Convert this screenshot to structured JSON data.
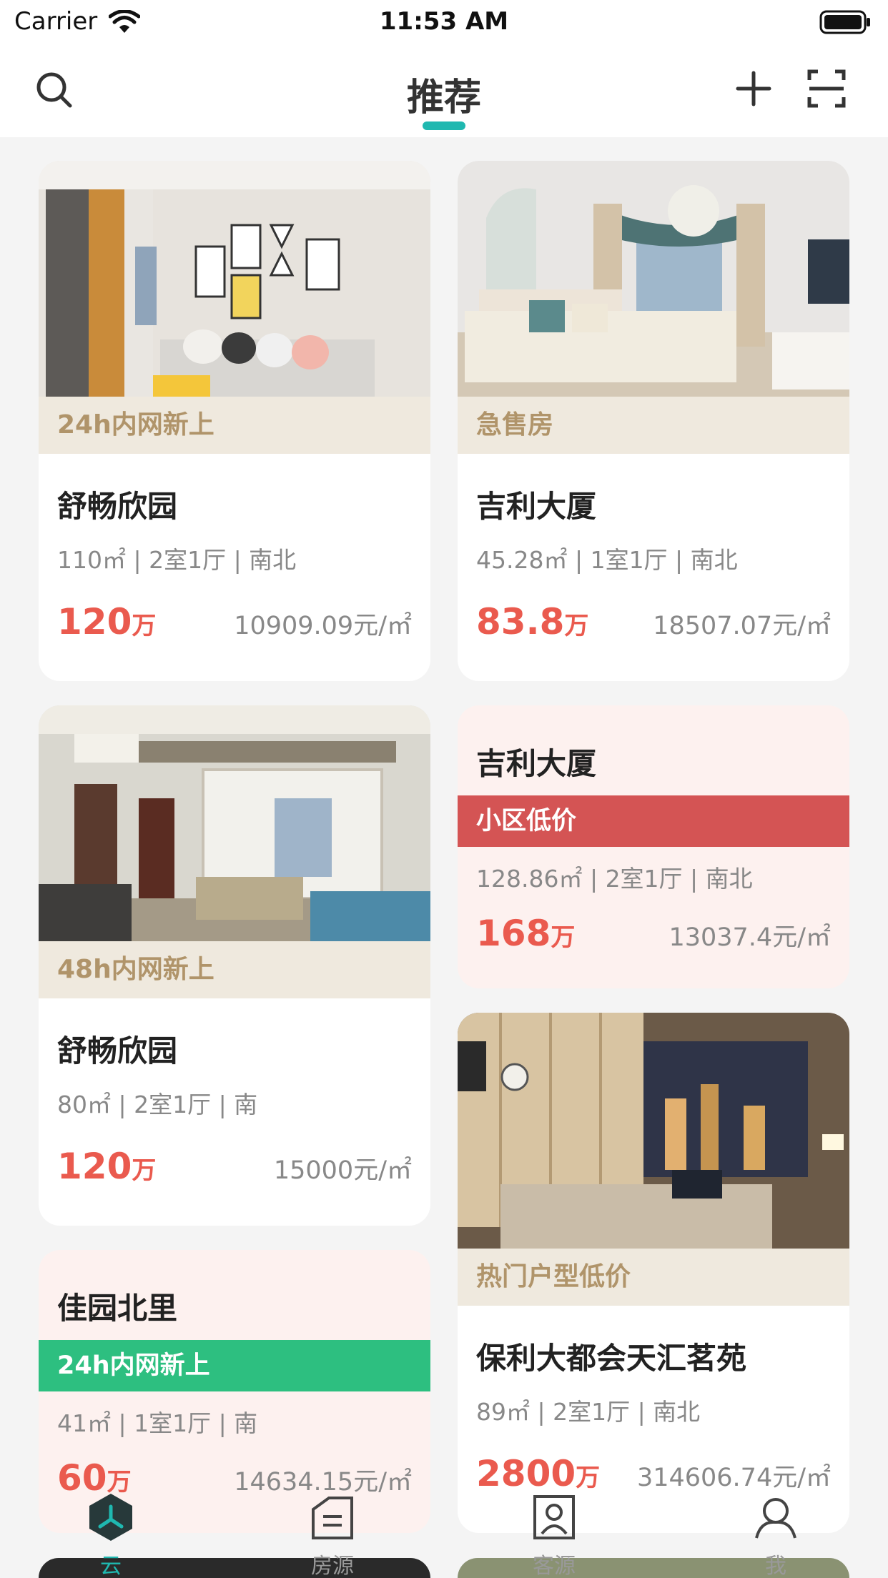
{
  "status_bar": {
    "carrier": "Carrier",
    "time": "11:53 AM"
  },
  "nav": {
    "title": "推荐",
    "accent_color": "#1fb8b0",
    "icons": [
      "search-icon",
      "plus-icon",
      "scan-icon"
    ]
  },
  "cards": [
    {
      "tag": "24h内网新上",
      "title": "舒畅欣园",
      "specs": "110㎡ | 2室1厅 | 南北",
      "price": "120",
      "price_unit": "万",
      "unit_price": "10909.09元/㎡"
    },
    {
      "tag": "急售房",
      "title": "吉利大厦",
      "specs": "45.28㎡ | 1室1厅 | 南北",
      "price": "83.8",
      "price_unit": "万",
      "unit_price": "18507.07元/㎡"
    },
    {
      "tag": "48h内网新上",
      "title": "舒畅欣园",
      "specs": "80㎡ | 2室1厅 | 南",
      "price": "120",
      "price_unit": "万",
      "unit_price": "15000元/㎡"
    },
    {
      "band": "小区低价",
      "band_color": "#d45454",
      "title": "吉利大厦",
      "specs": "128.86㎡ | 2室1厅 | 南北",
      "price": "168",
      "price_unit": "万",
      "unit_price": "13037.4元/㎡"
    },
    {
      "band": "24h内网新上",
      "band_color": "#2dbf80",
      "title": "佳园北里",
      "specs": "41㎡ | 1室1厅 | 南",
      "price": "60",
      "price_unit": "万",
      "unit_price": "14634.15元/㎡"
    },
    {
      "tag": "热门户型低价",
      "title": "保利大都会天汇茗苑",
      "specs": "89㎡ | 2室1厅 | 南北",
      "price": "2800",
      "price_unit": "万",
      "unit_price": "314606.74元/㎡"
    }
  ],
  "tab_bar": {
    "tabs": [
      {
        "label": "云",
        "icon": "cloud-hex-icon",
        "active": true
      },
      {
        "label": "房源",
        "icon": "listing-icon",
        "active": false
      },
      {
        "label": "客源",
        "icon": "client-icon",
        "active": false
      },
      {
        "label": "我",
        "icon": "profile-icon",
        "active": false
      }
    ]
  }
}
